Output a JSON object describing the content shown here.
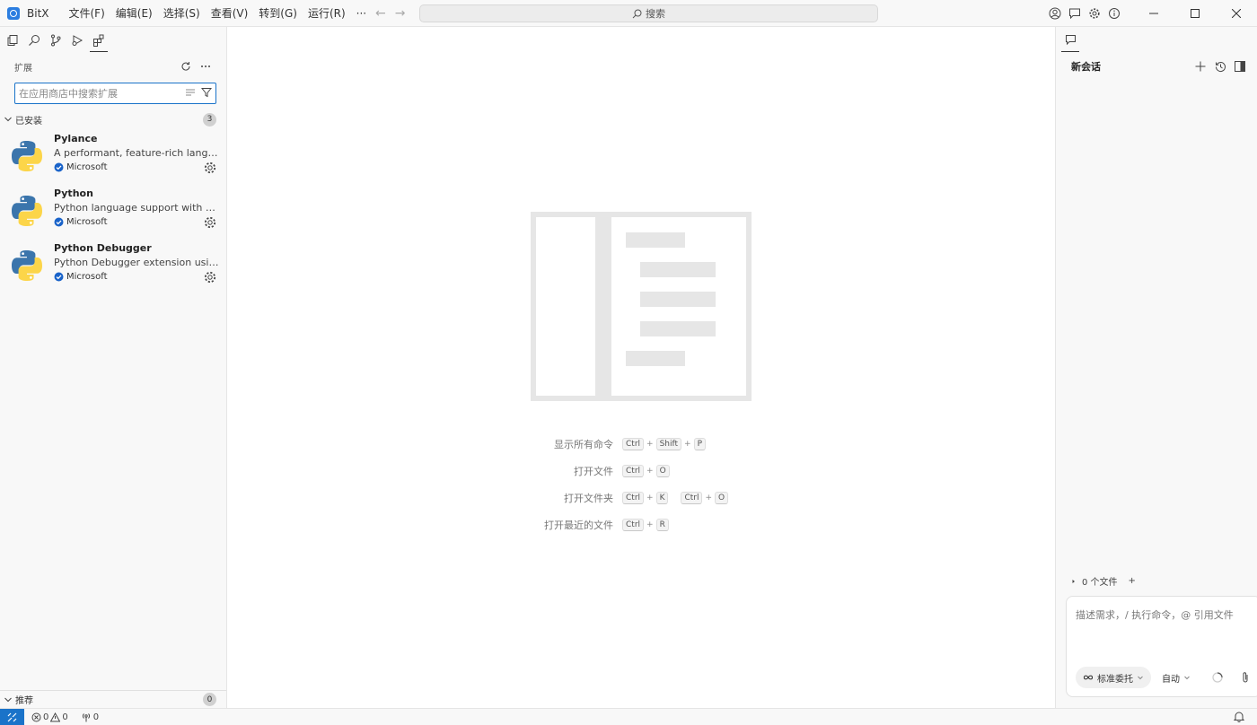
{
  "app": {
    "name": "BitX"
  },
  "menu": [
    "文件(F)",
    "编辑(E)",
    "选择(S)",
    "查看(V)",
    "转到(G)",
    "运行(R)",
    "···"
  ],
  "search": {
    "placeholder": "搜索"
  },
  "sidebar": {
    "title": "扩展",
    "search_placeholder": "在应用商店中搜索扩展",
    "installed": {
      "title": "已安装",
      "count": "3",
      "items": [
        {
          "name": "Pylance",
          "description": "A performant, feature-rich language server for Python",
          "publisher": "Microsoft"
        },
        {
          "name": "Python",
          "description": "Python language support with extension access points",
          "publisher": "Microsoft"
        },
        {
          "name": "Python Debugger",
          "description": "Python Debugger extension using debugpy",
          "publisher": "Microsoft"
        }
      ]
    },
    "recommended": {
      "title": "推荐",
      "count": "0"
    }
  },
  "shortcuts": [
    {
      "label": "显示所有命令",
      "keys": [
        "Ctrl",
        "Shift",
        "P"
      ]
    },
    {
      "label": "打开文件",
      "keys": [
        "Ctrl",
        "O"
      ]
    },
    {
      "label": "打开文件夹",
      "keys": [
        "Ctrl",
        "K"
      ],
      "keys2": [
        "Ctrl",
        "O"
      ]
    },
    {
      "label": "打开最近的文件",
      "keys": [
        "Ctrl",
        "R"
      ]
    }
  ],
  "chat": {
    "title": "新会话",
    "files_label": "0 个文件",
    "files_add": "+",
    "input_placeholder": "描述需求，/ 执行命令，@ 引用文件",
    "mode_label": "标准委托",
    "auto_label": "自动"
  },
  "status": {
    "errors": "0",
    "warnings": "0",
    "ports": "0"
  },
  "colors": {
    "accent": "#1a73c9",
    "verified": "#1a63c9"
  }
}
